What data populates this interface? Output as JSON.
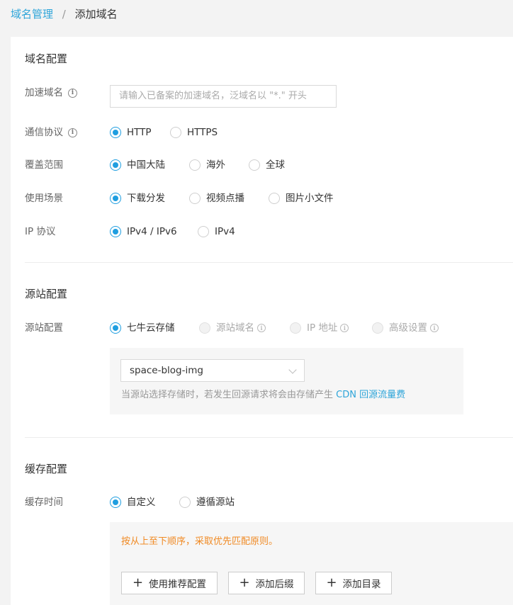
{
  "breadcrumb": {
    "parent": "域名管理",
    "separator": "/",
    "current": "添加域名"
  },
  "domain_config": {
    "title": "域名配置",
    "accel_domain": {
      "label": "加速域名",
      "placeholder": "请输入已备案的加速域名，泛域名以 \"*.\" 开头"
    },
    "protocol": {
      "label": "通信协议",
      "options": [
        "HTTP",
        "HTTPS"
      ],
      "selected": "HTTP"
    },
    "coverage": {
      "label": "覆盖范围",
      "options": [
        "中国大陆",
        "海外",
        "全球"
      ],
      "selected": "中国大陆"
    },
    "scenario": {
      "label": "使用场景",
      "options": [
        "下载分发",
        "视频点播",
        "图片小文件"
      ],
      "selected": "下载分发"
    },
    "ip": {
      "label": "IP 协议",
      "options": [
        "IPv4 / IPv6",
        "IPv4"
      ],
      "selected": "IPv4 / IPv6"
    }
  },
  "origin_config": {
    "title": "源站配置",
    "source": {
      "label": "源站配置",
      "options": [
        "七牛云存储",
        "源站域名",
        "IP 地址",
        "高级设置"
      ],
      "selected": "七牛云存储"
    },
    "bucket": {
      "value": "space-blog-img"
    },
    "hint": {
      "text": "当源站选择存储时，若发生回源请求将会由存储产生 ",
      "link": "CDN 回源流量费"
    }
  },
  "cache_config": {
    "title": "缓存配置",
    "cache_time": {
      "label": "缓存时间",
      "options": [
        "自定义",
        "遵循源站"
      ],
      "selected": "自定义"
    },
    "rule_hint": "按从上至下顺序，采取优先匹配原则。",
    "buttons": {
      "recommend": "使用推荐配置",
      "add_suffix": "添加后缀",
      "add_dir": "添加目录"
    }
  },
  "icons": {
    "info": "info-icon",
    "plus": "plus-icon",
    "chevron": "chevron-down-icon"
  },
  "colors": {
    "accent": "#1f9ee0",
    "link": "#2ea5d9",
    "warning": "#f08a24"
  }
}
